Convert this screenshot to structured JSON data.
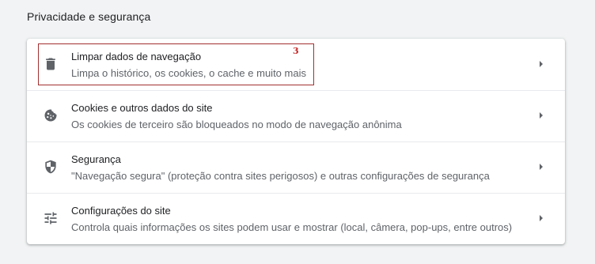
{
  "section": {
    "title": "Privacidade e segurança"
  },
  "rows": [
    {
      "icon": "trash-icon",
      "title": "Limpar dados de navegação",
      "subtitle": "Limpa o histórico, os cookies, o cache e muito mais"
    },
    {
      "icon": "cookie-icon",
      "title": "Cookies e outros dados do site",
      "subtitle": "Os cookies de terceiro são bloqueados no modo de navegação anônima"
    },
    {
      "icon": "shield-icon",
      "title": "Segurança",
      "subtitle": "\"Navegação segura\" (proteção contra sites perigosos) e outras configurações de segurança"
    },
    {
      "icon": "tune-icon",
      "title": "Configurações do site",
      "subtitle": "Controla quais informações os sites podem usar e mostrar (local, câmera, pop-ups, entre outros)"
    }
  ],
  "annotation": {
    "step_number": "3",
    "color": "#a33030"
  },
  "colors": {
    "page_background": "#f1f3f4",
    "card_background": "#ffffff",
    "title_text": "#202124",
    "secondary_text": "#5f6368",
    "icon": "#5f6368"
  }
}
